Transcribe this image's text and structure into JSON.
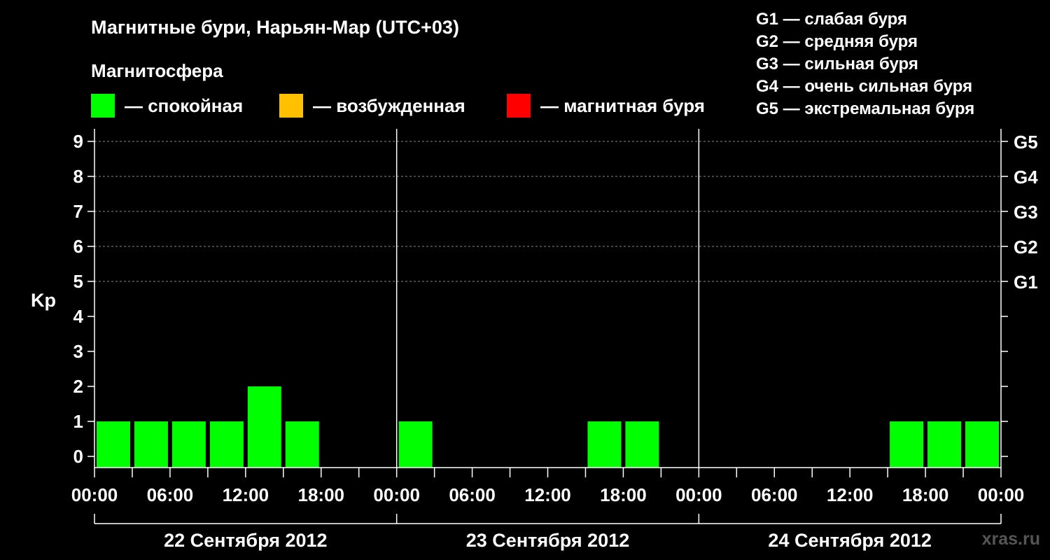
{
  "title": "Магнитные бури, Нарьян-Мар (UTC+03)",
  "subtitle": "Магнитосфера",
  "legend": [
    {
      "label": "— спокойная",
      "color": "#00ff00"
    },
    {
      "label": "— возбужденная",
      "color": "#ffc000"
    },
    {
      "label": "— магнитная буря",
      "color": "#ff0000"
    }
  ],
  "g_levels": [
    "G1 — слабая буря",
    "G2 — средняя буря",
    "G3 — сильная буря",
    "G4 — очень сильная буря",
    "G5 — экстремальная буря"
  ],
  "watermark": "xras.ru",
  "chart_data": {
    "type": "bar",
    "ylabel": "Kp",
    "ylim": [
      0,
      9
    ],
    "yticks": [
      "0",
      "1",
      "2",
      "3",
      "4",
      "5",
      "6",
      "7",
      "8",
      "9"
    ],
    "right_ticks": [
      {
        "value": 5,
        "label": "G1"
      },
      {
        "value": 6,
        "label": "G2"
      },
      {
        "value": 7,
        "label": "G3"
      },
      {
        "value": 8,
        "label": "G4"
      },
      {
        "value": 9,
        "label": "G5"
      }
    ],
    "xtick_labels": [
      "00:00",
      "06:00",
      "12:00",
      "18:00",
      "00:00",
      "06:00",
      "12:00",
      "18:00",
      "00:00",
      "06:00",
      "12:00",
      "18:00",
      "00:00"
    ],
    "days": [
      "22 Сентября 2012",
      "23 Сентября 2012",
      "24 Сентября 2012"
    ],
    "values": [
      1,
      1,
      1,
      1,
      2,
      1,
      0,
      0,
      1,
      0,
      0,
      0,
      0,
      1,
      1,
      0,
      0,
      0,
      0,
      0,
      0,
      1,
      1,
      1
    ],
    "bar_color": "#00ff00",
    "grid": true
  }
}
